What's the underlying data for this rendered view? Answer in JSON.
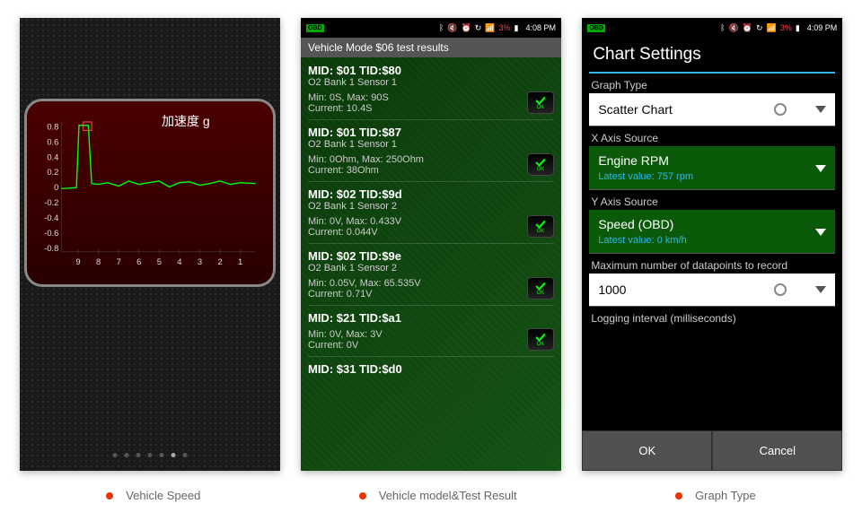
{
  "captions": {
    "c1": "Vehicle Speed",
    "c2": "Vehicle model&Test Result",
    "c3": "Graph Type"
  },
  "status": {
    "obd": "OBD",
    "pct2": "3%",
    "time2": "4:08 PM",
    "pct3": "3%",
    "time3": "4:09 PM"
  },
  "chart": {
    "title": "加速度 g"
  },
  "chart_data": {
    "type": "line",
    "title": "加速度 g",
    "xlabel": "",
    "ylabel": "",
    "x_ticks": [
      9,
      8,
      7,
      6,
      5,
      4,
      3,
      2,
      1
    ],
    "y_ticks": [
      -0.8,
      -0.6,
      -0.4,
      -0.2,
      0,
      0.2,
      0.4,
      0.6,
      0.8
    ],
    "ylim": [
      -0.9,
      0.9
    ],
    "series": [
      {
        "name": "acceleration_g",
        "x": [
          9.5,
          9.0,
          8.9,
          8.8,
          8.5,
          8.0,
          7.5,
          7.0,
          6.5,
          6.0,
          5.5,
          5.0,
          4.5,
          4.0,
          3.5,
          3.0,
          2.5,
          2.0,
          1.5,
          1.0,
          0.5
        ],
        "values": [
          0.0,
          0.02,
          0.9,
          0.9,
          0.06,
          0.04,
          0.06,
          0.02,
          0.08,
          0.04,
          0.06,
          0.08,
          0.02,
          0.06,
          0.07,
          0.03,
          0.05,
          0.08,
          0.04,
          0.06,
          0.05
        ]
      }
    ]
  },
  "tests": {
    "header": "Vehicle Mode $06 test results",
    "items": [
      {
        "label": "MID: $01 TID:$80",
        "sub": "O2 Bank 1 Sensor 1",
        "minmax": "Min: 0S, Max: 90S",
        "current": "Current: 10.4S",
        "ok": "OK"
      },
      {
        "label": "MID: $01 TID:$87",
        "sub": "O2 Bank 1 Sensor 1",
        "minmax": "Min: 0Ohm, Max: 250Ohm",
        "current": "Current: 38Ohm",
        "ok": "OK"
      },
      {
        "label": "MID: $02 TID:$9d",
        "sub": "O2 Bank 1 Sensor 2",
        "minmax": "Min: 0V, Max: 0.433V",
        "current": "Current: 0.044V",
        "ok": "OK"
      },
      {
        "label": "MID: $02 TID:$9e",
        "sub": "O2 Bank 1 Sensor 2",
        "minmax": "Min: 0.05V, Max: 65.535V",
        "current": "Current: 0.71V",
        "ok": "OK"
      },
      {
        "label": "MID: $21 TID:$a1",
        "sub": "",
        "minmax": "Min: 0V, Max: 3V",
        "current": "Current: 0V",
        "ok": "OK"
      },
      {
        "label": "MID: $31 TID:$d0",
        "sub": "",
        "minmax": "",
        "current": "",
        "ok": ""
      }
    ]
  },
  "settings": {
    "title": "Chart Settings",
    "graph_type_label": "Graph Type",
    "graph_type_value": "Scatter Chart",
    "x_axis_label": "X Axis Source",
    "x_axis_value": "Engine RPM",
    "x_axis_latest": "Latest value: 757 rpm",
    "y_axis_label": "Y Axis Source",
    "y_axis_value": "Speed (OBD)",
    "y_axis_latest": "Latest value: 0 km/h",
    "max_dp_label": "Maximum number of datapoints to record",
    "max_dp_value": "1000",
    "log_interval_label": "Logging interval (milliseconds)",
    "ok": "OK",
    "cancel": "Cancel"
  }
}
